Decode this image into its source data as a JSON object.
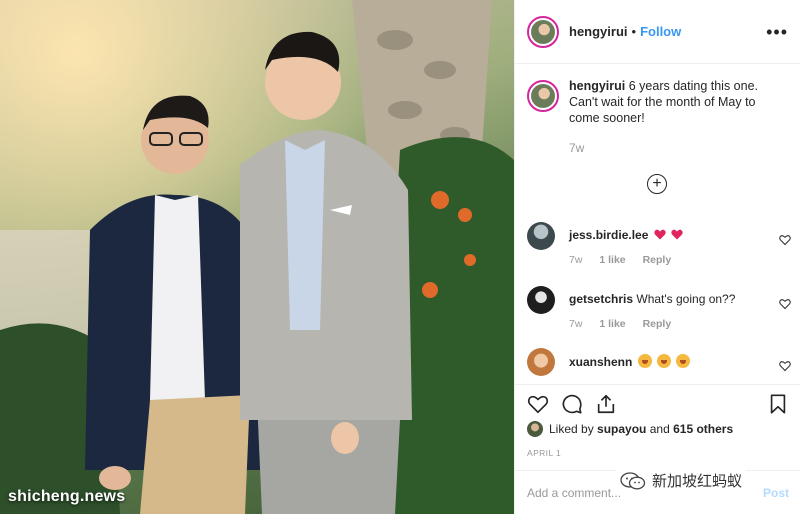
{
  "post": {
    "username": "hengyirui",
    "separator": "•",
    "follow_label": "Follow",
    "more_label": "•••",
    "caption": {
      "username": "hengyirui",
      "text": "6 years dating this one. Can't wait for the month of May to come sooner!",
      "time": "7w"
    },
    "load_more_label": "+",
    "comments": [
      {
        "username": "jess.birdie.lee",
        "text": "",
        "emoji": [
          "heart",
          "heart"
        ],
        "time": "7w",
        "likes": "1 like",
        "reply_label": "Reply"
      },
      {
        "username": "getsetchris",
        "text": "What's going on??",
        "emoji": [],
        "time": "7w",
        "likes": "1 like",
        "reply_label": "Reply"
      },
      {
        "username": "xuanshenn",
        "text": "",
        "emoji": [
          "face",
          "face",
          "face"
        ],
        "time": "",
        "likes": "",
        "reply_label": ""
      }
    ],
    "liked_by": {
      "prefix": "Liked by",
      "user": "supayou",
      "and": "and",
      "count": "615 others"
    },
    "date": "APRIL 1",
    "add_comment_placeholder": "Add a comment...",
    "post_label": "Post"
  },
  "watermark": "shicheng.news",
  "wechat_label": "新加坡红蚂蚁",
  "colors": {
    "link": "#3897f0",
    "muted": "#999999",
    "text": "#262626",
    "heart": "#ed4956"
  },
  "icons": [
    "heart-icon",
    "comment-icon",
    "share-icon",
    "bookmark-icon",
    "more-icon",
    "plus-circle-icon"
  ]
}
